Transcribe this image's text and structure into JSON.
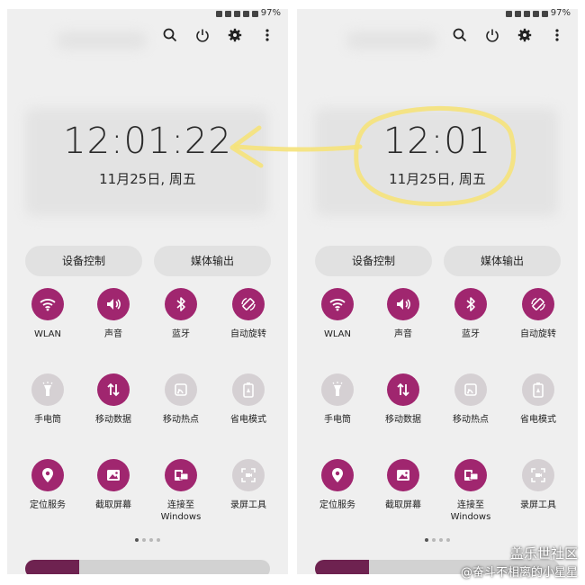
{
  "colors": {
    "accent": "#a0266f",
    "tile_off": "#d5d0d3",
    "annotation": "#f5e27a"
  },
  "panels": [
    {
      "status": {
        "battery": "97%"
      },
      "clock": "12:01:22",
      "date": "11月25日, 周五",
      "media": {
        "device_control": "设备控制",
        "media_output": "媒体输出"
      },
      "tiles": [
        {
          "label": "WLAN",
          "icon": "wifi-icon",
          "on": true
        },
        {
          "label": "声音",
          "icon": "volume-icon",
          "on": true
        },
        {
          "label": "蓝牙",
          "icon": "bluetooth-icon",
          "on": true
        },
        {
          "label": "自动旋转",
          "icon": "rotate-icon",
          "on": true
        },
        {
          "label": "手电筒",
          "icon": "flashlight-icon",
          "on": false
        },
        {
          "label": "移动数据",
          "icon": "mobile-data-icon",
          "on": true
        },
        {
          "label": "移动热点",
          "icon": "hotspot-icon",
          "on": false
        },
        {
          "label": "省电模式",
          "icon": "battery-saver-icon",
          "on": false
        },
        {
          "label": "定位服务",
          "icon": "location-icon",
          "on": true
        },
        {
          "label": "截取屏幕",
          "icon": "screenshot-icon",
          "on": true
        },
        {
          "label": "连接至\nWindows",
          "icon": "link-windows-icon",
          "on": true
        },
        {
          "label": "录屏工具",
          "icon": "screen-record-icon",
          "on": false
        }
      ],
      "brightness_level": 0.22
    },
    {
      "status": {
        "battery": "97%"
      },
      "clock": "12:01",
      "date": "11月25日, 周五",
      "media": {
        "device_control": "设备控制",
        "media_output": "媒体输出"
      },
      "tiles": [
        {
          "label": "WLAN",
          "icon": "wifi-icon",
          "on": true
        },
        {
          "label": "声音",
          "icon": "volume-icon",
          "on": true
        },
        {
          "label": "蓝牙",
          "icon": "bluetooth-icon",
          "on": true
        },
        {
          "label": "自动旋转",
          "icon": "rotate-icon",
          "on": true
        },
        {
          "label": "手电筒",
          "icon": "flashlight-icon",
          "on": false
        },
        {
          "label": "移动数据",
          "icon": "mobile-data-icon",
          "on": true
        },
        {
          "label": "移动热点",
          "icon": "hotspot-icon",
          "on": false
        },
        {
          "label": "省电模式",
          "icon": "battery-saver-icon",
          "on": false
        },
        {
          "label": "定位服务",
          "icon": "location-icon",
          "on": true
        },
        {
          "label": "截取屏幕",
          "icon": "screenshot-icon",
          "on": true
        },
        {
          "label": "连接至\nWindows",
          "icon": "link-windows-icon",
          "on": true
        },
        {
          "label": "录屏工具",
          "icon": "screen-record-icon",
          "on": false
        }
      ],
      "brightness_level": 0.22
    }
  ],
  "watermark": {
    "line1": "盖乐世社区",
    "line2": "@奋斗不相离的小星星"
  }
}
